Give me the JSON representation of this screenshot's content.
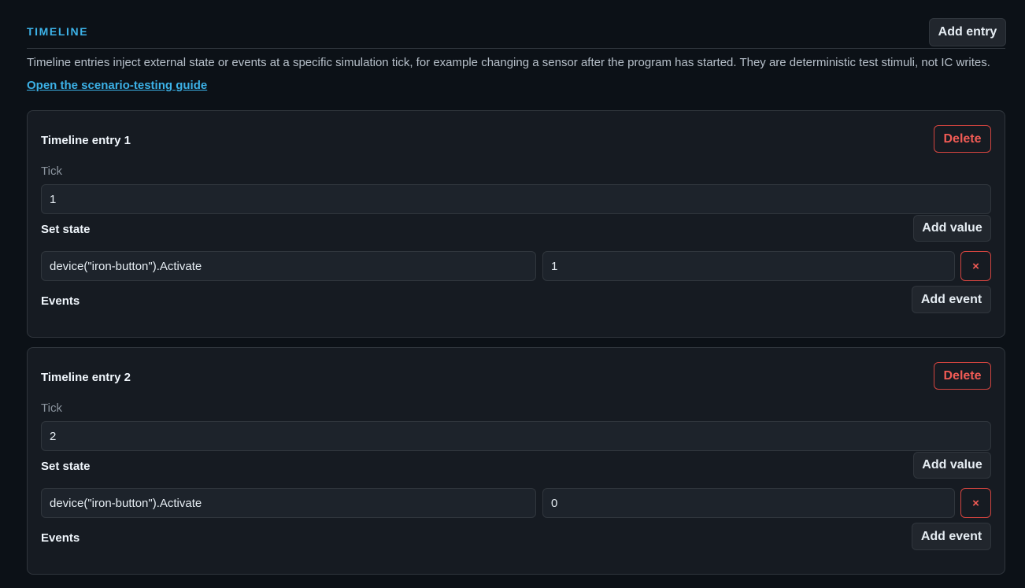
{
  "section": {
    "title": "TIMELINE",
    "add_entry_label": "Add entry",
    "description": "Timeline entries inject external state or events at a specific simulation tick, for example changing a sensor after the program has started. They are deterministic test stimuli, not IC writes.",
    "guide_link": "Open the scenario-testing guide"
  },
  "entries": [
    {
      "title": "Timeline entry 1",
      "delete_label": "Delete",
      "tick_label": "Tick",
      "tick_value": "1",
      "set_state_label": "Set state",
      "add_value_label": "Add value",
      "state_key": "device(\"iron-button\").Activate",
      "state_value": "1",
      "remove_label": "×",
      "events_label": "Events",
      "add_event_label": "Add event"
    },
    {
      "title": "Timeline entry 2",
      "delete_label": "Delete",
      "tick_label": "Tick",
      "tick_value": "2",
      "set_state_label": "Set state",
      "add_value_label": "Add value",
      "state_key": "device(\"iron-button\").Activate",
      "state_value": "0",
      "remove_label": "×",
      "events_label": "Events",
      "add_event_label": "Add event"
    }
  ]
}
